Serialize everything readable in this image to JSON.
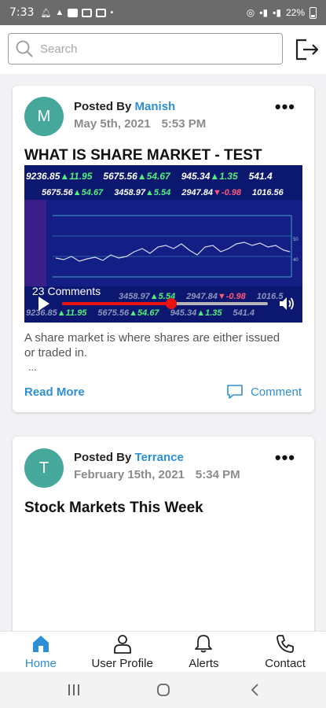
{
  "status_bar": {
    "time": "7:33",
    "battery": "22%"
  },
  "search": {
    "placeholder": "Search",
    "value": ""
  },
  "posts": [
    {
      "avatar_initial": "M",
      "posted_by_label": "Posted By",
      "author": "Manish",
      "date": "May 5th, 2021",
      "time": "5:53 PM",
      "title": "WHAT IS SHARE MARKET - TEST",
      "video": {
        "ticker_row1": [
          {
            "value": "9236.85",
            "dir": "up",
            "change": "11.95"
          },
          {
            "value": "5675.56",
            "dir": "up",
            "change": "54.67"
          },
          {
            "value": "945.34",
            "dir": "up",
            "change": "1.35"
          },
          {
            "value": "541.4",
            "dir": "",
            "change": ""
          }
        ],
        "ticker_row2": [
          {
            "value": "5675.56",
            "dir": "up",
            "change": "54.67"
          },
          {
            "value": "3458.97",
            "dir": "up",
            "change": "5.54"
          },
          {
            "value": "2947.84",
            "dir": "down",
            "change": "-0.98"
          },
          {
            "value": "1016.56",
            "dir": "",
            "change": ""
          }
        ],
        "ticker_row3": [
          {
            "value": "3458.97",
            "dir": "up",
            "change": "5.54"
          },
          {
            "value": "2947.84",
            "dir": "down",
            "change": "-0.98"
          },
          {
            "value": "1016.5",
            "dir": "",
            "change": ""
          }
        ],
        "ticker_row4": [
          {
            "value": "9236.85",
            "dir": "up",
            "change": "11.95"
          },
          {
            "value": "5675.56",
            "dir": "up",
            "change": "54.67"
          },
          {
            "value": "945.34",
            "dir": "up",
            "change": "1.35"
          },
          {
            "value": "541.4",
            "dir": "",
            "change": ""
          }
        ],
        "comments_count": "23 Comments",
        "progress": 0.53
      },
      "excerpt": "A share market is where shares are either issued or traded in.",
      "ellipsis": "...",
      "read_more": "Read More",
      "comment_label": "Comment"
    },
    {
      "avatar_initial": "T",
      "posted_by_label": "Posted By",
      "author": "Terrance",
      "date": "February 15th, 2021",
      "time": "5:34 PM",
      "title": "Stock Markets This Week"
    }
  ],
  "bottom_nav": [
    {
      "label": "Home",
      "icon": "home-icon",
      "active": true
    },
    {
      "label": "User Profile",
      "icon": "user-icon",
      "active": false
    },
    {
      "label": "Alerts",
      "icon": "bell-icon",
      "active": false
    },
    {
      "label": "Contact",
      "icon": "phone-icon",
      "active": false
    }
  ],
  "colors": {
    "accent": "#2d8fd6",
    "avatar": "#46a79b",
    "seek": "#ee1111"
  }
}
